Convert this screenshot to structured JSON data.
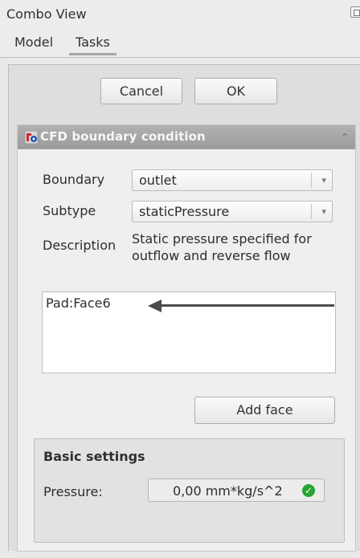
{
  "window": {
    "title": "Combo View"
  },
  "tabs": [
    {
      "label": "Model"
    },
    {
      "label": "Tasks"
    }
  ],
  "buttons": {
    "cancel": "Cancel",
    "ok": "OK"
  },
  "panel": {
    "title": "CFD boundary condition",
    "collapse_icon": "double-chevron-up-icon"
  },
  "form": {
    "boundary_label": "Boundary",
    "boundary_value": "outlet",
    "subtype_label": "Subtype",
    "subtype_value": "staticPressure",
    "description_label": "Description",
    "description_text": "Static pressure specified for outflow and reverse flow"
  },
  "faces": {
    "items": [
      "Pad:Face6"
    ],
    "annotation_icon": "left-arrow-icon"
  },
  "add_face": {
    "label": "Add face"
  },
  "basic_settings": {
    "title": "Basic settings",
    "pressure_label": "Pressure:",
    "pressure_value": "0,00 mm*kg/s^2",
    "status_icon": "check-icon"
  }
}
